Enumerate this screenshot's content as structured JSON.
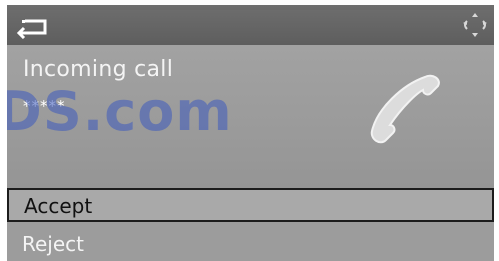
{
  "header": {
    "back_icon": "back-arrow-icon",
    "nav_icon": "navigation-arrows-icon"
  },
  "call": {
    "title": "Incoming call",
    "caller_id": "*****",
    "phone_icon": "phone-handset-icon"
  },
  "watermark": "DS.com",
  "menu": {
    "items": [
      {
        "label": "Accept",
        "selected": true
      },
      {
        "label": "Reject",
        "selected": false
      }
    ]
  },
  "colors": {
    "panel": "#9a9a9a",
    "topbar": "#666666",
    "text_light": "#f4f4f4",
    "text_dark": "#111111",
    "watermark": "#3c5abe"
  }
}
